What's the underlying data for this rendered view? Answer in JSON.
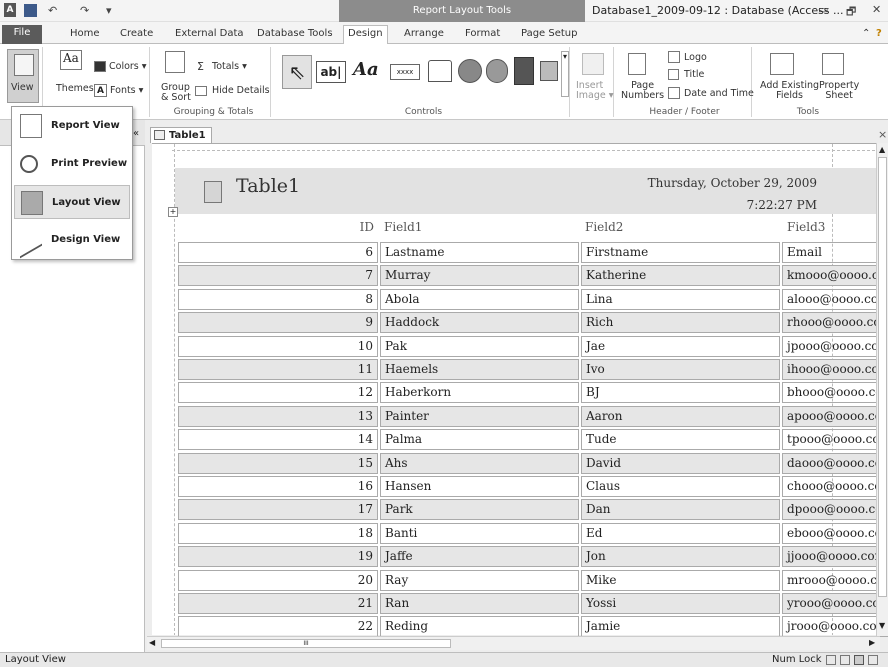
{
  "titlebar": {
    "context_title": "Report Layout Tools",
    "doc_title": "Database1_2009-09-12 : Database (Access ...",
    "minimize": "▭",
    "restore": "🗗",
    "close": "✕",
    "qa_undo": "↶",
    "qa_redo": "↷",
    "qa_dd": "▾"
  },
  "tabs": {
    "file": "File",
    "home": "Home",
    "create": "Create",
    "external": "External Data",
    "dbtools": "Database Tools",
    "design": "Design",
    "arrange": "Arrange",
    "format": "Format",
    "pagesetup": "Page Setup",
    "help": "?"
  },
  "ribbon": {
    "view": "View",
    "themes": "Themes",
    "colors": "Colors ▾",
    "fonts": "Fonts ▾",
    "group_sort": "Group\n& Sort",
    "totals": "Totals ▾",
    "hide_details": "Hide Details",
    "grouping_label": "Grouping & Totals",
    "controls_label": "Controls",
    "insert_image": "Insert\nImage ▾",
    "page_numbers": "Page\nNumbers",
    "logo": "Logo",
    "title": "Title",
    "date_time": "Date and Time",
    "header_footer_label": "Header / Footer",
    "add_fields": "Add Existing\nFields",
    "property_sheet": "Property\nSheet",
    "tools_label": "Tools",
    "label_control": "ab|",
    "text_control": "Aa",
    "xxxx": "xxxx"
  },
  "viewmenu": {
    "items": [
      {
        "label": "Report View"
      },
      {
        "label": "Print Preview"
      },
      {
        "label": "Layout View"
      },
      {
        "label": "Design View"
      }
    ]
  },
  "doc": {
    "tab_label": "Table1"
  },
  "report": {
    "title": "Table1",
    "date": "Thursday, October 29, 2009",
    "time": "7:22:27 PM",
    "headers": {
      "id": "ID",
      "f1": "Field1",
      "f2": "Field2",
      "f3": "Field3"
    },
    "rows": [
      {
        "id": "6",
        "f1": "Lastname",
        "f2": "Firstname",
        "f3": "Email"
      },
      {
        "id": "7",
        "f1": "Murray",
        "f2": "Katherine",
        "f3": "kmooo@oooo.cc"
      },
      {
        "id": "8",
        "f1": "Abola",
        "f2": "Lina",
        "f3": "alooo@oooo.con"
      },
      {
        "id": "9",
        "f1": "Haddock",
        "f2": "Rich",
        "f3": "rhooo@oooo.cor"
      },
      {
        "id": "10",
        "f1": "Pak",
        "f2": "Jae",
        "f3": "jpooo@oooo.cor"
      },
      {
        "id": "11",
        "f1": "Haemels",
        "f2": "Ivo",
        "f3": "ihooo@oooo.cor"
      },
      {
        "id": "12",
        "f1": "Haberkorn",
        "f2": "BJ",
        "f3": "bhooo@oooo.co"
      },
      {
        "id": "13",
        "f1": "Painter",
        "f2": "Aaron",
        "f3": "apooo@oooo.cor"
      },
      {
        "id": "14",
        "f1": "Palma",
        "f2": "Tude",
        "f3": "tpooo@oooo.cor"
      },
      {
        "id": "15",
        "f1": "Ahs",
        "f2": "David",
        "f3": "daooo@oooo.cor"
      },
      {
        "id": "16",
        "f1": "Hansen",
        "f2": "Claus",
        "f3": "chooo@oooo.co"
      },
      {
        "id": "17",
        "f1": "Park",
        "f2": "Dan",
        "f3": "dpooo@oooo.co"
      },
      {
        "id": "18",
        "f1": "Banti",
        "f2": "Ed",
        "f3": "ebooo@oooo.co"
      },
      {
        "id": "19",
        "f1": "Jaffe",
        "f2": "Jon",
        "f3": "jjooo@oooo.com"
      },
      {
        "id": "20",
        "f1": "Ray",
        "f2": "Mike",
        "f3": "mrooo@oooo.co"
      },
      {
        "id": "21",
        "f1": "Ran",
        "f2": "Yossi",
        "f3": "yrooo@oooo.cor"
      },
      {
        "id": "22",
        "f1": "Reding",
        "f2": "Jamie",
        "f3": "jrooo@oooo.con"
      }
    ]
  },
  "status": {
    "left": "Layout View",
    "numlock": "Num Lock",
    "scroll_mid": "III"
  }
}
